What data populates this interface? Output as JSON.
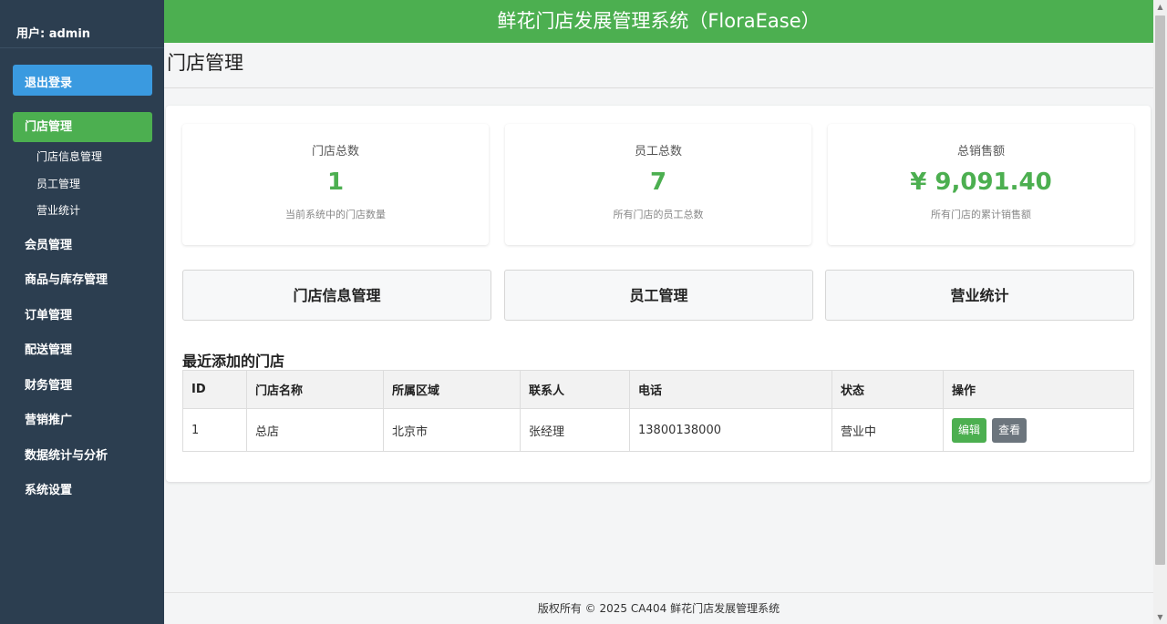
{
  "sidebar": {
    "user": "用户: admin",
    "logout_label": "退出登录",
    "nav": [
      {
        "label": "门店管理"
      },
      {
        "label": "门店信息管理"
      },
      {
        "label": "员工管理"
      },
      {
        "label": "营业统计"
      },
      {
        "label": "会员管理"
      },
      {
        "label": "商品与库存管理"
      },
      {
        "label": "订单管理"
      },
      {
        "label": "配送管理"
      },
      {
        "label": "财务管理"
      },
      {
        "label": "营销推广"
      },
      {
        "label": "数据统计与分析"
      },
      {
        "label": "系统设置"
      }
    ]
  },
  "header": {
    "title": "鲜花门店发展管理系统（FloraEase）"
  },
  "page": {
    "title": "门店管理"
  },
  "stats": [
    {
      "label": "门店总数",
      "value": "1",
      "desc": "当前系统中的门店数量"
    },
    {
      "label": "员工总数",
      "value": "7",
      "desc": "所有门店的员工总数"
    },
    {
      "label": "总销售额",
      "value": "¥ 9,091.40",
      "desc": "所有门店的累计销售额"
    }
  ],
  "quick_links": [
    {
      "label": "门店信息管理"
    },
    {
      "label": "员工管理"
    },
    {
      "label": "营业统计"
    }
  ],
  "recent": {
    "title": "最近添加的门店",
    "headers": [
      "ID",
      "门店名称",
      "所属区域",
      "联系人",
      "电话",
      "状态",
      "操作"
    ],
    "rows": [
      {
        "id": "1",
        "name": "总店",
        "region": "北京市",
        "contact": "张经理",
        "phone": "13800138000",
        "status": "营业中",
        "edit_label": "编辑",
        "view_label": "查看"
      }
    ]
  },
  "footer": {
    "text": "版权所有 © 2025 CA404 鲜花门店发展管理系统"
  },
  "colors": {
    "primary": "#4caf50",
    "sidebar": "#2c3e50",
    "logout": "#3a9ae0",
    "secondary": "#6c757d"
  },
  "icons": {
    "scroll_up": "triangle-up-icon",
    "scroll_down": "triangle-down-icon"
  }
}
